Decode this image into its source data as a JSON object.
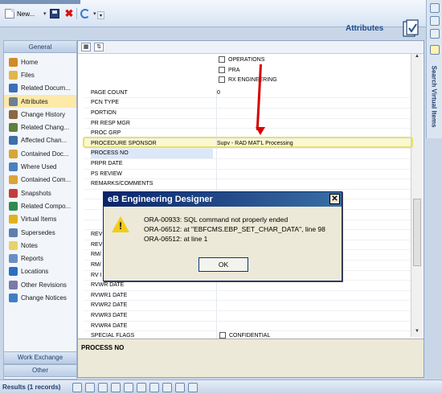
{
  "toolbar": {
    "new_label": "New...",
    "new_dropdown": "▾",
    "refresh_dropdown": "▾",
    "overflow": "▾"
  },
  "header": {
    "title": "Attributes"
  },
  "nav": {
    "header": "General",
    "items": [
      {
        "label": "Home",
        "icon": "home-icon",
        "color": "#d08a28",
        "active": false
      },
      {
        "label": "Files",
        "icon": "files-icon",
        "color": "#e0b64a",
        "active": false
      },
      {
        "label": "Related Docum...",
        "icon": "related-documents-icon",
        "color": "#3a6fb8",
        "active": false
      },
      {
        "label": "Attributes",
        "icon": "attributes-icon",
        "color": "#6e7f95",
        "active": true
      },
      {
        "label": "Change History",
        "icon": "change-history-icon",
        "color": "#8a6a3f",
        "active": false
      },
      {
        "label": "Related Chang...",
        "icon": "related-changes-icon",
        "color": "#5f7f3a",
        "active": false
      },
      {
        "label": "Affected Chan...",
        "icon": "affected-changes-icon",
        "color": "#3e6ea8",
        "active": false
      },
      {
        "label": "Contained Doc...",
        "icon": "contained-documents-icon",
        "color": "#d9a43a",
        "active": false
      },
      {
        "label": "Where Used",
        "icon": "where-used-icon",
        "color": "#4d7fbf",
        "active": false
      },
      {
        "label": "Contained Com...",
        "icon": "contained-components-icon",
        "color": "#d9a43a",
        "active": false
      },
      {
        "label": "Snapshots",
        "icon": "snapshots-icon",
        "color": "#c43c3c",
        "active": false
      },
      {
        "label": "Related Compo...",
        "icon": "related-components-icon",
        "color": "#2f8a4f",
        "active": false
      },
      {
        "label": "Virtual Items",
        "icon": "virtual-items-icon",
        "color": "#e0b21f",
        "active": false
      },
      {
        "label": "Supersedes",
        "icon": "supersedes-icon",
        "color": "#5c7fb0",
        "active": false
      },
      {
        "label": "Notes",
        "icon": "notes-icon",
        "color": "#e8d26a",
        "active": false
      },
      {
        "label": "Reports",
        "icon": "reports-icon",
        "color": "#6a8ec2",
        "active": false
      },
      {
        "label": "Locations",
        "icon": "locations-icon",
        "color": "#2b6fc0",
        "active": false
      },
      {
        "label": "Other Revisions",
        "icon": "other-revisions-icon",
        "color": "#7a7aa8",
        "active": false
      },
      {
        "label": "Change Notices",
        "icon": "change-notices-icon",
        "color": "#3f7fc4",
        "active": false
      }
    ],
    "footer_work": "Work Exchange",
    "footer_other": "Other"
  },
  "grid": {
    "sort_icon": "⇅",
    "checkbox_options": [
      "OPERATIONS",
      "PRA",
      "RX ENGINEERING"
    ],
    "rows": [
      {
        "label": "PAGE COUNT",
        "value": "0"
      },
      {
        "label": "PCN TYPE",
        "value": ""
      },
      {
        "label": "PORTION",
        "value": ""
      },
      {
        "label": "PR RESP MGR",
        "value": ""
      },
      {
        "label": "PROC GRP",
        "value": ""
      },
      {
        "label": "PROCEDURE SPONSOR",
        "value": "Supv - RAD MAT'L Processing"
      },
      {
        "label": "PROCESS NO",
        "value": ""
      },
      {
        "label": "PRPR DATE",
        "value": ""
      },
      {
        "label": "PS REVIEW",
        "value": ""
      },
      {
        "label": "REMARKS/COMMENTS",
        "value": ""
      },
      {
        "label": "",
        "value": ""
      },
      {
        "label": "",
        "value": ""
      },
      {
        "label": "",
        "value": ""
      },
      {
        "label": "",
        "value": ""
      },
      {
        "label": "REV",
        "value": ""
      },
      {
        "label": "REV",
        "value": ""
      },
      {
        "label": "RM/",
        "value": ""
      },
      {
        "label": "RM/",
        "value": ""
      },
      {
        "label": "RV I",
        "value": ""
      },
      {
        "label": "RVWR DATE",
        "value": ""
      },
      {
        "label": "RVWR1 DATE",
        "value": ""
      },
      {
        "label": "RVWR2 DATE",
        "value": ""
      },
      {
        "label": "RVWR3 DATE",
        "value": ""
      },
      {
        "label": "RVWR4 DATE",
        "value": ""
      },
      {
        "label": "SPECIAL FLAGS",
        "value": "CONFIDENTIAL"
      }
    ]
  },
  "description": {
    "title": "PROCESS NO"
  },
  "side": {
    "vertical_label": "Search Virtual Items"
  },
  "dialog": {
    "title": "eB Engineering Designer",
    "close": "✕",
    "lines": [
      "ORA-00933: SQL command not properly ended",
      "ORA-06512: at \"EBFCMS.EBP_SET_CHAR_DATA\", line 98",
      "ORA-06512: at line 1"
    ],
    "ok_label": "OK",
    "icon": "warning-icon"
  },
  "status": {
    "text": "Results (1 records)"
  },
  "colors": {
    "accent": "#1f4e8c",
    "highlight": "#e8e06a",
    "arrow": "#d60000",
    "warning": "#f2cc18"
  }
}
